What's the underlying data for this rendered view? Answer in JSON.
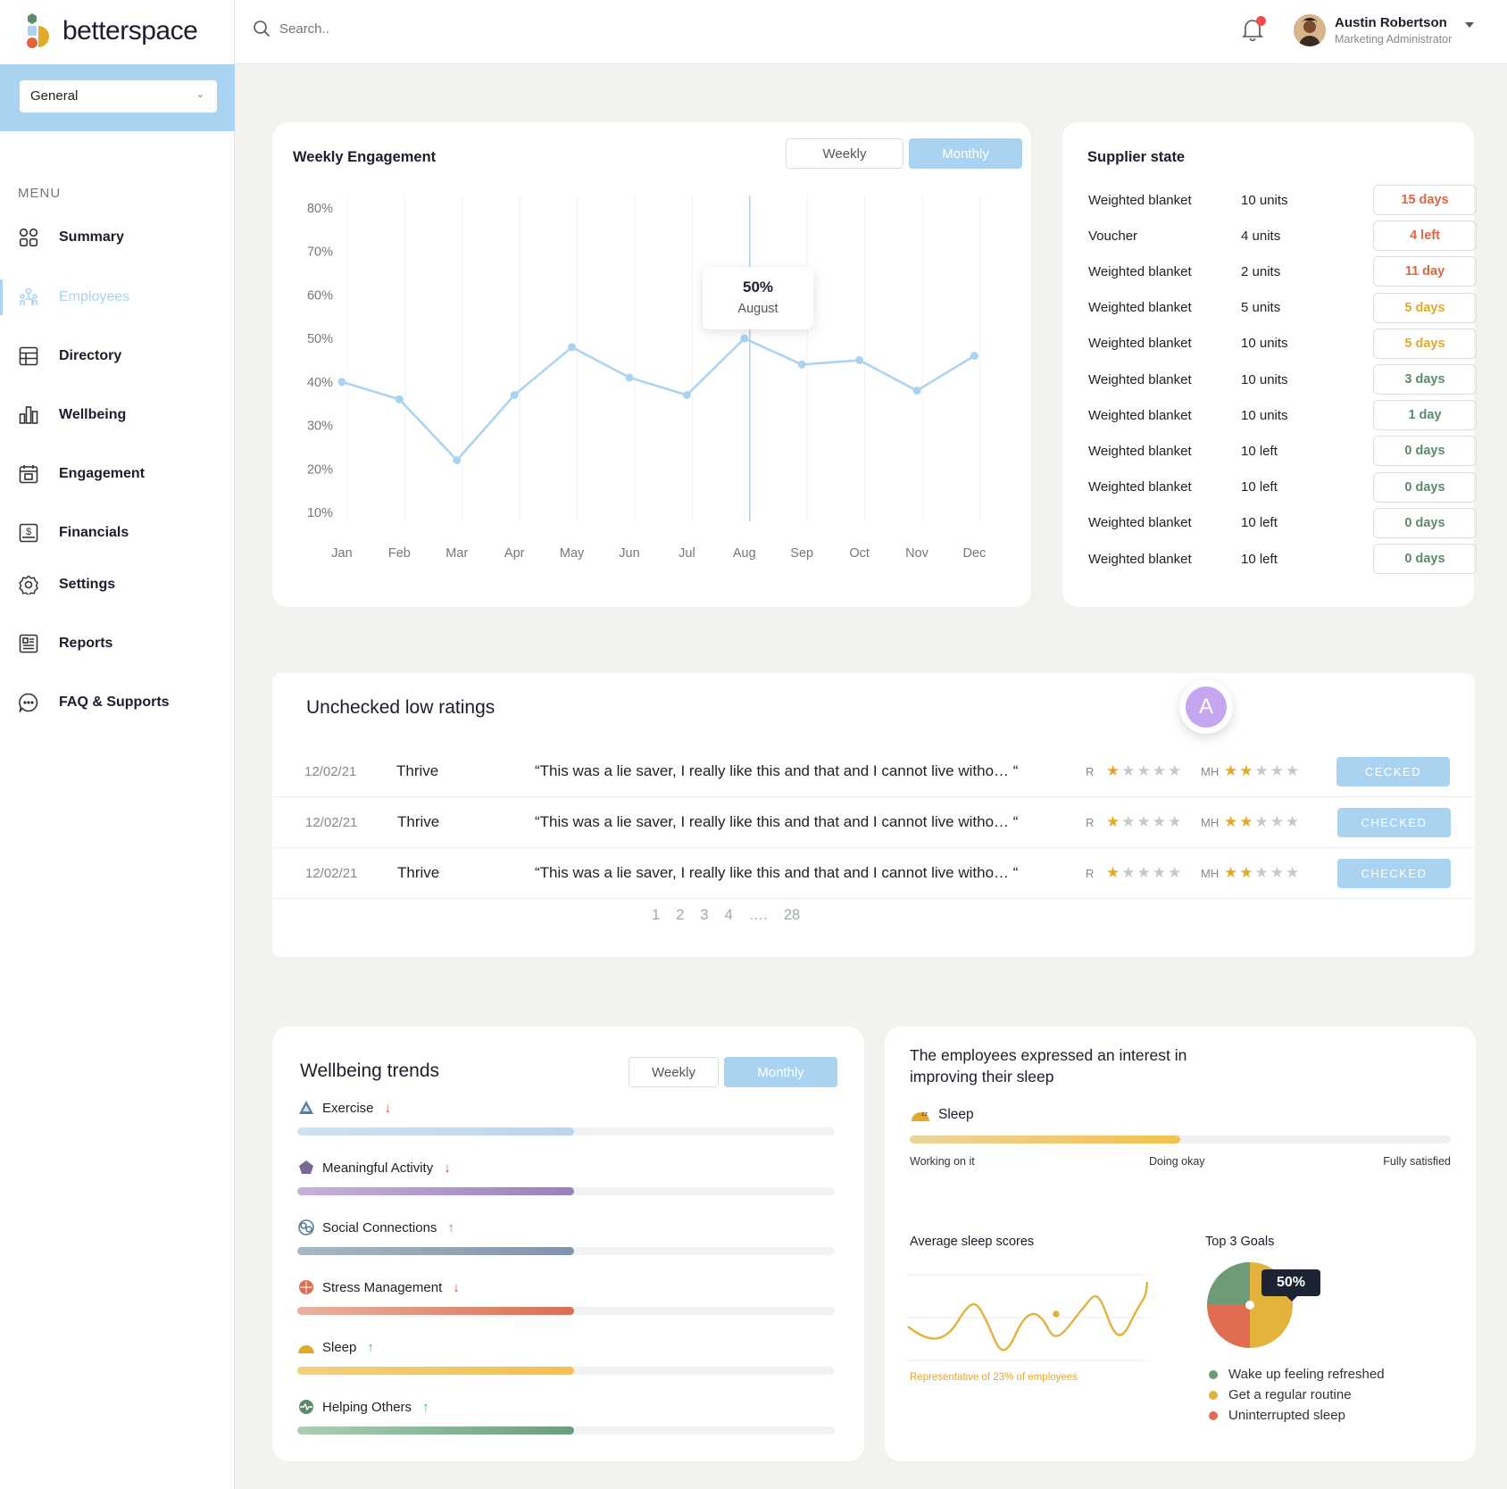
{
  "brand": {
    "name": "betterspace"
  },
  "sidebar": {
    "selector_value": "General",
    "menu_label": "MENU",
    "items": [
      {
        "label": "Summary",
        "icon": "grid-icon"
      },
      {
        "label": "Employees",
        "icon": "people-icon"
      },
      {
        "label": "Directory",
        "icon": "table-icon"
      },
      {
        "label": "Wellbeing",
        "icon": "bar-chart-icon"
      },
      {
        "label": "Engagement",
        "icon": "calendar-icon"
      },
      {
        "label": "Financials",
        "icon": "dollar-icon"
      },
      {
        "label": "Settings",
        "icon": "gear-icon"
      },
      {
        "label": "Reports",
        "icon": "newspaper-icon"
      },
      {
        "label": "FAQ & Supports",
        "icon": "chat-icon"
      }
    ]
  },
  "topbar": {
    "search_placeholder": "Search..",
    "user_name": "Austin Robertson",
    "user_role": "Marketing Administrator"
  },
  "engagement": {
    "title": "Weekly Engagement",
    "toggle_weekly": "Weekly",
    "toggle_monthly": "Monthly",
    "tooltip_value": "50%",
    "tooltip_label": "August"
  },
  "chart_data": {
    "type": "line",
    "categories": [
      "Jan",
      "Feb",
      "Mar",
      "Apr",
      "May",
      "Jun",
      "Jul",
      "Aug",
      "Sep",
      "Oct",
      "Nov",
      "Dec"
    ],
    "values": [
      40,
      36,
      22,
      37,
      48,
      41,
      37,
      50,
      44,
      45,
      38,
      46
    ],
    "y_ticks": [
      "80%",
      "70%",
      "60%",
      "50%",
      "40%",
      "30%",
      "20%",
      "10%"
    ],
    "ylim": [
      10,
      80
    ],
    "color": "#a9d3f0",
    "highlight_index": 7
  },
  "supplier": {
    "title": "Supplier state",
    "rows": [
      {
        "item": "Weighted blanket",
        "units": "10 units",
        "status": "15 days",
        "color": "#e0653f"
      },
      {
        "item": "Voucher",
        "units": "4 units",
        "status": "4 left",
        "color": "#e0653f"
      },
      {
        "item": "Weighted blanket",
        "units": "2 units",
        "status": "11 day",
        "color": "#e0653f"
      },
      {
        "item": "Weighted blanket",
        "units": "5 units",
        "status": "5 days",
        "color": "#e3a92b"
      },
      {
        "item": "Weighted blanket",
        "units": "10 units",
        "status": "5 days",
        "color": "#e3a92b"
      },
      {
        "item": "Weighted blanket",
        "units": "10 units",
        "status": "3 days",
        "color": "#5d8a6a"
      },
      {
        "item": "Weighted blanket",
        "units": "10 units",
        "status": "1 day",
        "color": "#5d8a6a"
      },
      {
        "item": "Weighted blanket",
        "units": "10 left",
        "status": "0 days",
        "color": "#5d8a6a"
      },
      {
        "item": "Weighted blanket",
        "units": "10 left",
        "status": "0 days",
        "color": "#5d8a6a"
      },
      {
        "item": "Weighted blanket",
        "units": "10 left",
        "status": "0 days",
        "color": "#5d8a6a"
      },
      {
        "item": "Weighted blanket",
        "units": "10 left",
        "status": "0 days",
        "color": "#5d8a6a"
      }
    ]
  },
  "ratings": {
    "title": "Unchecked low ratings",
    "avatar_letter": "A",
    "rows": [
      {
        "date": "12/02/21",
        "name": "Thrive",
        "quote": "“This was a lie saver, I really like this and that and I cannot live witho… “",
        "r_label": "R",
        "r_stars": 1,
        "mh_label": "MH",
        "mh_stars": 2,
        "button": "CECKED"
      },
      {
        "date": "12/02/21",
        "name": "Thrive",
        "quote": "“This was a lie saver, I really like this and that and I cannot live witho… “",
        "r_label": "R",
        "r_stars": 1,
        "mh_label": "MH",
        "mh_stars": 2,
        "button": "CHECKED"
      },
      {
        "date": "12/02/21",
        "name": "Thrive",
        "quote": "“This was a lie saver, I really like this and that and I cannot live witho… “",
        "r_label": "R",
        "r_stars": 1,
        "mh_label": "MH",
        "mh_stars": 2,
        "button": "CHECKED"
      }
    ],
    "pages": [
      "1",
      "2",
      "3",
      "4",
      "….",
      "28"
    ]
  },
  "wellbeing": {
    "title": "Wellbeing trends",
    "toggle_weekly": "Weekly",
    "toggle_monthly": "Monthly",
    "items": [
      {
        "label": "Exercise",
        "trend": "down",
        "value": 0.515,
        "color_a": "#cde2f1",
        "color_b": "#b9d6ec"
      },
      {
        "label": "Meaningful Activity",
        "trend": "down",
        "value": 0.515,
        "color_a": "#c4b3d8",
        "color_b": "#9a80b8"
      },
      {
        "label": "Social Connections",
        "trend": "up",
        "value": 0.515,
        "color_a": "#a5b8c8",
        "color_b": "#7d95ab"
      },
      {
        "label": "Stress Management",
        "trend": "down",
        "value": 0.515,
        "color_a": "#e9b3a1",
        "color_b": "#db6d52"
      },
      {
        "label": "Sleep",
        "trend": "up",
        "value": 0.515,
        "color_a": "#f3cf78",
        "color_b": "#f2c14e"
      },
      {
        "label": "Helping Others",
        "trend": "up",
        "value": 0.515,
        "color_a": "#a9cfb4",
        "color_b": "#6a9e7d"
      }
    ]
  },
  "sleep": {
    "title_line1": "The employees expressed an interest in",
    "title_line2": "improving their sleep",
    "label": "Sleep",
    "progress": 0.5,
    "scale_left": "Working on it",
    "scale_mid": "Doing okay",
    "scale_right": "Fully satisfied",
    "avg_title": "Average sleep scores",
    "avg_note": "Representative of 23% of employees",
    "goals_title": "Top 3 Goals",
    "goals_badge": "50%",
    "goals": [
      {
        "label": "Wake up feeling refreshed",
        "color": "#6f9a77",
        "share": 0.25
      },
      {
        "label": "Get a regular routine",
        "color": "#e3b23c",
        "share": 0.5
      },
      {
        "label": "Uninterrupted sleep",
        "color": "#e06d52",
        "share": 0.25
      }
    ]
  }
}
